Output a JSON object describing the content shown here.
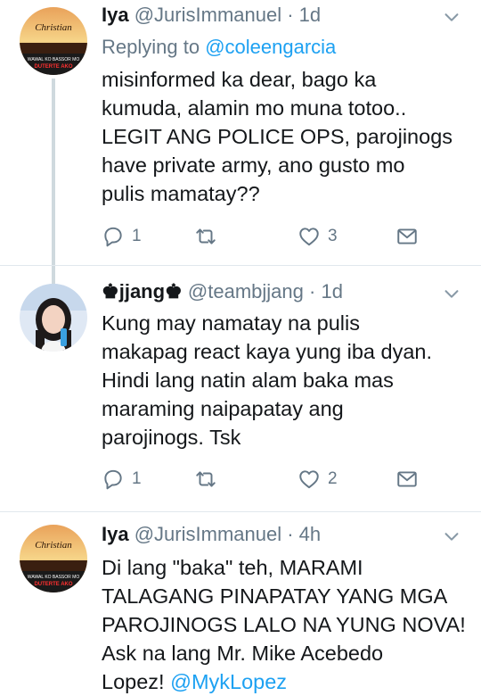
{
  "tweets": [
    {
      "name": "Iya",
      "handle": "@JurisImmanuel",
      "sep": " · ",
      "time": "1d",
      "replying_prefix": "Replying to ",
      "replying_to": "@coleengarcia",
      "text_lines": [
        "misinformed ka dear, bago ka",
        "kumuda, alamin mo muna totoo..",
        "LEGIT ANG POLICE OPS, parojinogs",
        "have private army, ano gusto mo",
        "pulis mamatay??"
      ],
      "replies": "1",
      "retweets": "",
      "likes": "3",
      "avatar": {
        "label_top": "Christian",
        "label_mid": "WAWAL KO BASSOR MO",
        "label_bottom": "DUTERTE AKO"
      }
    },
    {
      "name": "♚jjang♚",
      "handle": "@teambjjang",
      "sep": " · ",
      "time": "1d",
      "text_lines": [
        "Kung may namatay na pulis",
        "makapag react kaya yung iba dyan.",
        "Hindi lang natin alam baka mas",
        "maraming naipapatay ang",
        "parojinogs. Tsk"
      ],
      "replies": "1",
      "retweets": "",
      "likes": "2"
    },
    {
      "name": "Iya",
      "handle": "@JurisImmanuel",
      "sep": " · ",
      "time": "4h",
      "text_lines": [
        "Di lang \"baka\" teh, MARAMI",
        "TALAGANG PINAPATAY YANG MGA",
        "PAROJINOGS LALO NA YUNG NOVA!",
        "Ask na lang Mr. Mike Acebedo"
      ],
      "last_line_prefix": "Lopez! ",
      "last_line_mention": "@MykLopez",
      "avatar": {
        "label_top": "Christian",
        "label_mid": "WAWAL KO BASSOR MO",
        "label_bottom": "DUTERTE AKO"
      }
    }
  ],
  "icons": [
    "reply-icon",
    "retweet-icon",
    "like-icon",
    "dm-icon",
    "chevron-down-icon"
  ],
  "colors": {
    "text": "#14171a",
    "secondary": "#657786",
    "link": "#1da1f2",
    "thread": "#cfd9de"
  }
}
